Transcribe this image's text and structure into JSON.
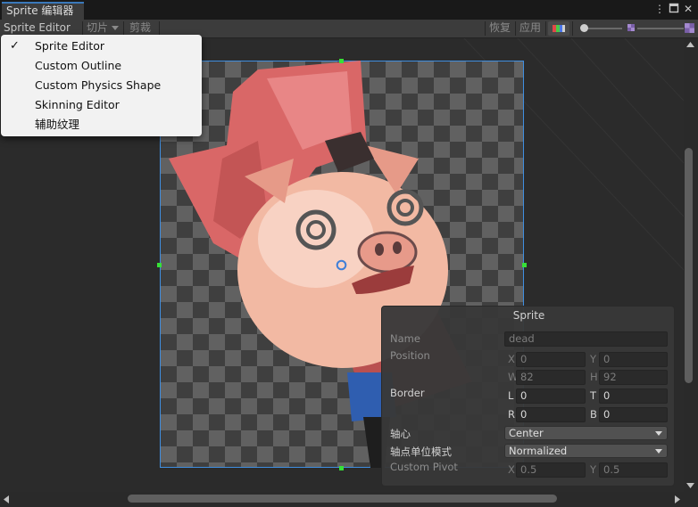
{
  "window": {
    "tab_title": "Sprite 编辑器",
    "menu_icon": "kebab-menu-icon",
    "maximize_icon": "maximize-icon",
    "close_icon": "close-icon"
  },
  "toolbar": {
    "mode_dropdown": "Sprite Editor",
    "slice_dropdown": "切片",
    "trim_button": "剪裁",
    "revert_button": "恢复",
    "apply_button": "应用",
    "color_toggle_icon": "rgb-channel-icon",
    "zoom_slider_value": 0,
    "mip_slider_value": 1
  },
  "mode_menu": {
    "items": [
      {
        "label": "Sprite Editor",
        "checked": true
      },
      {
        "label": "Custom Outline",
        "checked": false
      },
      {
        "label": "Custom Physics Shape",
        "checked": false
      },
      {
        "label": "Skinning Editor",
        "checked": false
      },
      {
        "label": "辅助纹理",
        "checked": false
      }
    ],
    "check_glyph": "✓"
  },
  "canvas": {
    "sprite_image": "pig-character-sprite",
    "pivot_icon": "pivot-circle-icon"
  },
  "sprite_panel": {
    "title": "Sprite",
    "name_label": "Name",
    "name_value": "dead",
    "position_label": "Position",
    "x_label": "X",
    "x_value": "0",
    "y_label": "Y",
    "y_value": "0",
    "w_label": "W",
    "w_value": "82",
    "h_label": "H",
    "h_value": "92",
    "border_label": "Border",
    "l_label": "L",
    "l_value": "0",
    "t_label": "T",
    "t_value": "0",
    "r_label": "R",
    "r_value": "0",
    "b_label": "B",
    "b_value": "0",
    "pivot_label": "轴心",
    "pivot_value": "Center",
    "pivot_unit_label": "轴点单位模式",
    "pivot_unit_value": "Normalized",
    "custom_pivot_label": "Custom Pivot",
    "cp_x_label": "X",
    "cp_x_value": "0.5",
    "cp_y_label": "Y",
    "cp_y_value": "0.5"
  },
  "colors": {
    "accent_blue": "#3f8ee0",
    "handle_green": "#37e037",
    "menu_bg": "#f2f2f2"
  }
}
